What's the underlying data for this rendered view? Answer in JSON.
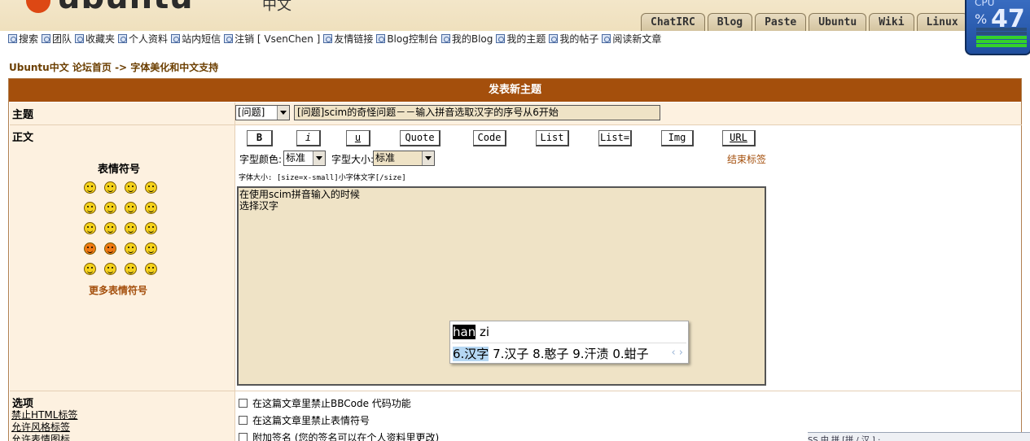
{
  "header": {
    "logo_text": "ubuntu",
    "logo_cn": "中文",
    "tabs": [
      "ChatIRC",
      "Blog",
      "Paste",
      "Ubuntu",
      "Wiki",
      "Linux"
    ]
  },
  "cpu_monitor": {
    "label": "CPU",
    "percent_sign": "%",
    "value": "47",
    "level": 0.47
  },
  "nav_links": [
    "搜索",
    "团队",
    "收藏夹",
    "个人资料",
    "站内短信",
    "注销 [ VsenChen ]",
    "友情链接",
    "Blog控制台",
    "我的Blog",
    "我的主题",
    "我的帖子",
    "阅读新文章"
  ],
  "breadcrumb": {
    "home": "Ubuntu中文 论坛首页",
    "sep": " -> ",
    "current": "字体美化和中文支持"
  },
  "form": {
    "title": "发表新主题",
    "subject_label": "主题",
    "subject_prefix": "[问题]",
    "subject_value": "[问题]scim的奇怪问题－－输入拼音选取汉字的序号从6开始",
    "body_label": "正文",
    "smilies_title": "表情符号",
    "more_smilies": "更多表情符号",
    "bbcode_buttons": [
      "B",
      "i",
      "u",
      "Quote",
      "Code",
      "List",
      "List=",
      "Img",
      "URL"
    ],
    "color_label": "字型颜色:",
    "color_value": "标准",
    "size_label": "字型大小:",
    "size_value": "标准",
    "close_tags": "结束标签",
    "help_text": "字体大小: [size=x-small]小字体文字[/size]",
    "body_lines": [
      "在使用scim拼音输入的时候",
      "选择汉字"
    ]
  },
  "ime": {
    "pinyin_selected": "han",
    "pinyin_rest": " zi",
    "candidate_selected": "6.汉字",
    "candidates": " 7.汉子 8.憨子 9.汗渍 0.蚶子",
    "nav": "‹ ›"
  },
  "options": {
    "label": "选项",
    "left": [
      "禁止HTML标签",
      "允许风格标签",
      "允许表情图标"
    ],
    "checks": [
      "在这篇文章里禁止BBCode 代码功能",
      "在这篇文章里禁止表情符号",
      "附加签名 (您的签名可以在个人资料里更改)"
    ]
  },
  "taskbar_text": "SS 中 拼 [拼 / 汉 ] ·,"
}
